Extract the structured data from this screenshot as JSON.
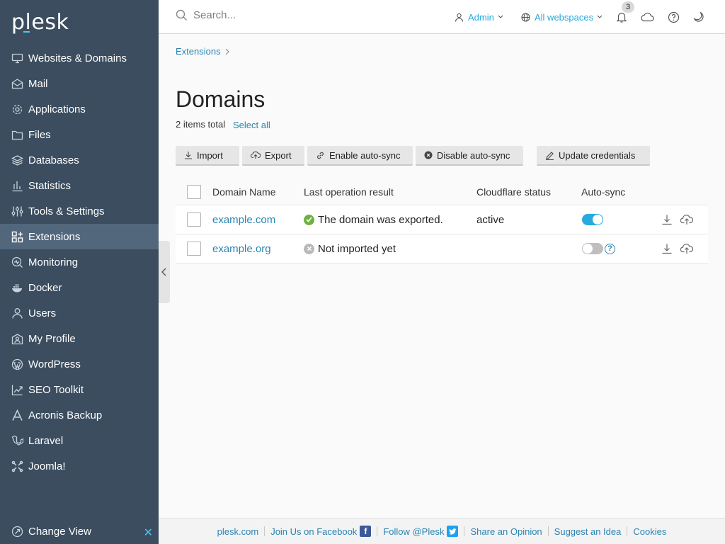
{
  "brand": {
    "logo": "plesk",
    "accent": "#4cc6f7"
  },
  "sidebar": {
    "items": [
      {
        "label": "Websites & Domains",
        "icon": "monitor-icon"
      },
      {
        "label": "Mail",
        "icon": "mail-icon"
      },
      {
        "label": "Applications",
        "icon": "gear-icon"
      },
      {
        "label": "Files",
        "icon": "folder-icon"
      },
      {
        "label": "Databases",
        "icon": "database-icon"
      },
      {
        "label": "Statistics",
        "icon": "bar-chart-icon"
      },
      {
        "label": "Tools & Settings",
        "icon": "sliders-icon"
      },
      {
        "label": "Extensions",
        "icon": "extensions-icon",
        "active": true
      },
      {
        "label": "Monitoring",
        "icon": "monitoring-icon"
      },
      {
        "label": "Docker",
        "icon": "docker-icon"
      },
      {
        "label": "Users",
        "icon": "user-icon"
      },
      {
        "label": "My Profile",
        "icon": "profile-icon"
      },
      {
        "label": "WordPress",
        "icon": "wordpress-icon"
      },
      {
        "label": "SEO Toolkit",
        "icon": "seo-icon"
      },
      {
        "label": "Acronis Backup",
        "icon": "acronis-icon"
      },
      {
        "label": "Laravel",
        "icon": "laravel-icon"
      },
      {
        "label": "Joomla!",
        "icon": "joomla-icon"
      }
    ],
    "change_view": "Change View"
  },
  "topbar": {
    "search_placeholder": "Search...",
    "admin": "Admin",
    "webspaces": "All webspaces",
    "notifications_count": "3"
  },
  "breadcrumb": {
    "item": "Extensions"
  },
  "page": {
    "title": "Domains",
    "count": "2 items total",
    "select_all": "Select all"
  },
  "toolbar": {
    "import": "Import",
    "export": "Export",
    "enable_autosync": "Enable auto-sync",
    "disable_autosync": "Disable auto-sync",
    "update_credentials": "Update credentials"
  },
  "table": {
    "headers": {
      "domain": "Domain Name",
      "last_op": "Last operation result",
      "cf_status": "Cloudflare status",
      "autosync": "Auto-sync"
    },
    "rows": [
      {
        "domain": "example.com",
        "result": "The domain was exported.",
        "result_state": "success",
        "cf_status": "active",
        "autosync": true
      },
      {
        "domain": "example.org",
        "result": "Not imported yet",
        "result_state": "none",
        "cf_status": "",
        "autosync": false
      }
    ]
  },
  "footer": {
    "site": "plesk.com",
    "facebook": "Join Us on Facebook",
    "twitter": "Follow @Plesk",
    "opinion": "Share an Opinion",
    "idea": "Suggest an Idea",
    "cookies": "Cookies"
  },
  "colors": {
    "sidebar_bg": "#3b4d5f",
    "sidebar_active": "#53677c",
    "link": "#2a84b3",
    "toggle_on": "#28aade",
    "success": "#6cb33e",
    "facebook": "#3b5998",
    "twitter": "#1da1f2"
  }
}
